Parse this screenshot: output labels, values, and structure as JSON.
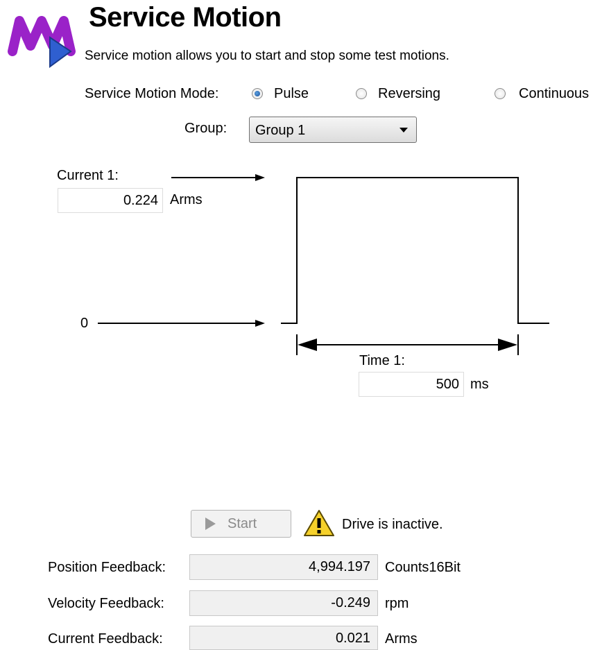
{
  "header": {
    "title": "Service Motion",
    "subtitle": "Service motion allows you to start and stop some test motions."
  },
  "mode": {
    "label": "Service Motion Mode:",
    "options": [
      {
        "label": "Pulse",
        "selected": true
      },
      {
        "label": "Reversing",
        "selected": false
      },
      {
        "label": "Continuous",
        "selected": false
      }
    ]
  },
  "group": {
    "label": "Group:",
    "value": "Group 1"
  },
  "diagram": {
    "current_label": "Current 1:",
    "current_value": "0.224",
    "current_unit": "Arms",
    "zero_label": "0",
    "time_label": "Time 1:",
    "time_value": "500",
    "time_unit": "ms"
  },
  "controls": {
    "start_label": "Start",
    "status_text": "Drive is inactive."
  },
  "feedback": [
    {
      "label": "Position Feedback:",
      "value": "4,994.197",
      "unit": "Counts16Bit"
    },
    {
      "label": "Velocity Feedback:",
      "value": "-0.249",
      "unit": "rpm"
    },
    {
      "label": "Current Feedback:",
      "value": "0.021",
      "unit": "Arms"
    }
  ],
  "colors": {
    "logo_purple": "#9a22c8",
    "logo_blue": "#2f5fd0",
    "warning_yellow": "#f6d12a"
  }
}
